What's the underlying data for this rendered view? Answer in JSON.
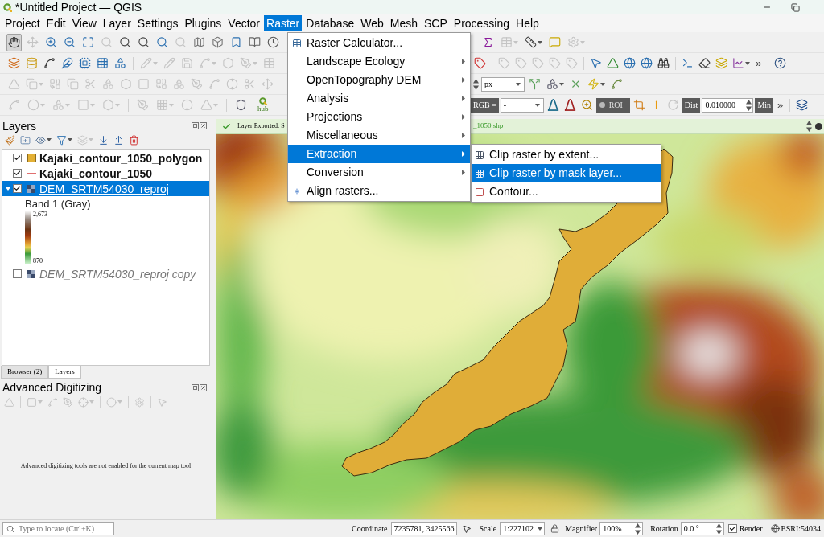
{
  "window": {
    "title": "*Untitled Project — QGIS"
  },
  "menu_bar": [
    {
      "label": "Project",
      "selected": false
    },
    {
      "label": "Edit",
      "selected": false
    },
    {
      "label": "View",
      "selected": false
    },
    {
      "label": "Layer",
      "selected": false
    },
    {
      "label": "Settings",
      "selected": false
    },
    {
      "label": "Plugins",
      "selected": false
    },
    {
      "label": "Vector",
      "selected": false
    },
    {
      "label": "Raster",
      "selected": true
    },
    {
      "label": "Database",
      "selected": false
    },
    {
      "label": "Web",
      "selected": false
    },
    {
      "label": "Mesh",
      "selected": false
    },
    {
      "label": "SCP",
      "selected": false
    },
    {
      "label": "Processing",
      "selected": false
    },
    {
      "label": "Help",
      "selected": false
    }
  ],
  "toolbars": [
    {
      "left": [
        {
          "kind": "button",
          "disabled": false,
          "pressed": true
        },
        {
          "kind": "button",
          "disabled": true,
          "pressed": false
        },
        {
          "kind": "button",
          "disabled": false,
          "pressed": false
        },
        {
          "kind": "button",
          "disabled": false,
          "pressed": false
        },
        {
          "kind": "button",
          "disabled": false,
          "pressed": false
        },
        {
          "kind": "button",
          "disabled": true,
          "pressed": false
        },
        {
          "kind": "button",
          "disabled": false,
          "pressed": false
        },
        {
          "kind": "button",
          "disabled": false,
          "pressed": false
        },
        {
          "kind": "button",
          "disabled": false,
          "pressed": false
        },
        {
          "kind": "button",
          "disabled": true,
          "pressed": false
        },
        {
          "kind": "button",
          "disabled": false,
          "pressed": false
        },
        {
          "kind": "button",
          "disabled": false,
          "pressed": false
        },
        {
          "kind": "button",
          "disabled": false,
          "pressed": false
        },
        {
          "kind": "button",
          "disabled": false,
          "pressed": false
        },
        {
          "kind": "button",
          "disabled": false,
          "pressed": false
        }
      ],
      "right": [
        {
          "kind": "button",
          "disabled": false
        },
        {
          "kind": "button",
          "disabled": true
        },
        {
          "kind": "button",
          "disabled": false
        },
        {
          "kind": "button",
          "disabled": false
        },
        {
          "kind": "button",
          "disabled": true
        }
      ]
    },
    {
      "left": [
        {
          "kind": "button",
          "disabled": false
        },
        {
          "kind": "button",
          "disabled": false
        },
        {
          "kind": "button",
          "disabled": false
        },
        {
          "kind": "button",
          "disabled": false
        },
        {
          "kind": "button",
          "disabled": false
        },
        {
          "kind": "button",
          "disabled": false
        },
        {
          "kind": "button",
          "disabled": false
        },
        {
          "kind": "button",
          "disabled": true
        },
        {
          "kind": "button",
          "disabled": true
        },
        {
          "kind": "button",
          "disabled": true
        },
        {
          "kind": "button",
          "disabled": true
        },
        {
          "kind": "button",
          "disabled": true
        },
        {
          "kind": "button",
          "disabled": true
        },
        {
          "kind": "button",
          "disabled": true
        }
      ],
      "right": [
        {
          "kind": "button",
          "disabled": false
        },
        {
          "kind": "button",
          "disabled": true
        },
        {
          "kind": "button",
          "disabled": true
        },
        {
          "kind": "button",
          "disabled": true
        },
        {
          "kind": "button",
          "disabled": true
        },
        {
          "kind": "button",
          "disabled": true
        },
        {
          "kind": "button",
          "disabled": false
        },
        {
          "kind": "button",
          "disabled": false
        },
        {
          "kind": "button",
          "disabled": false
        },
        {
          "kind": "button",
          "disabled": false
        },
        {
          "kind": "button",
          "disabled": false
        },
        {
          "kind": "button",
          "disabled": false
        },
        {
          "kind": "button",
          "disabled": false
        },
        {
          "kind": "button",
          "disabled": false
        },
        {
          "kind": "button",
          "disabled": false
        },
        {
          "kind": "overflow",
          "text": "»"
        },
        {
          "kind": "button",
          "disabled": false
        }
      ]
    },
    {
      "left": [
        {
          "kind": "button",
          "disabled": true
        },
        {
          "kind": "button",
          "disabled": true
        },
        {
          "kind": "button",
          "disabled": true
        },
        {
          "kind": "button",
          "disabled": true
        },
        {
          "kind": "button",
          "disabled": true
        },
        {
          "kind": "button",
          "disabled": true
        },
        {
          "kind": "button",
          "disabled": true
        },
        {
          "kind": "button",
          "disabled": true
        },
        {
          "kind": "button",
          "disabled": true
        },
        {
          "kind": "button",
          "disabled": true
        },
        {
          "kind": "button",
          "disabled": true
        },
        {
          "kind": "button",
          "disabled": true
        },
        {
          "kind": "button",
          "disabled": true
        },
        {
          "kind": "button",
          "disabled": true
        },
        {
          "kind": "button",
          "disabled": true
        }
      ],
      "right": [
        {
          "kind": "spin_arrows"
        },
        {
          "kind": "dropdown",
          "value": "px"
        },
        {
          "kind": "button",
          "disabled": false
        },
        {
          "kind": "button",
          "disabled": false
        },
        {
          "kind": "button",
          "disabled": false
        },
        {
          "kind": "button",
          "disabled": false
        },
        {
          "kind": "button",
          "disabled": false
        }
      ]
    },
    {
      "left": [
        {
          "kind": "button",
          "disabled": true
        },
        {
          "kind": "button",
          "disabled": true
        },
        {
          "kind": "button",
          "disabled": true
        },
        {
          "kind": "button",
          "disabled": true
        },
        {
          "kind": "button",
          "disabled": true
        },
        {
          "kind": "button",
          "disabled": true
        },
        {
          "kind": "button",
          "disabled": true
        },
        {
          "kind": "button",
          "disabled": true
        },
        {
          "kind": "button",
          "disabled": true
        },
        {
          "kind": "button",
          "disabled": false
        },
        {
          "kind": "hub",
          "text": "hub"
        }
      ],
      "right": [
        {
          "kind": "label",
          "text": "RGB ="
        },
        {
          "kind": "dropdown",
          "value": "-"
        },
        {
          "kind": "button",
          "disabled": false
        },
        {
          "kind": "button",
          "disabled": false
        },
        {
          "kind": "button",
          "disabled": false
        },
        {
          "kind": "toggle",
          "text": "ROI"
        },
        {
          "kind": "button",
          "disabled": false
        },
        {
          "kind": "button",
          "disabled": false
        },
        {
          "kind": "button",
          "disabled": true
        },
        {
          "kind": "label",
          "text": "Dist"
        },
        {
          "kind": "spinbox",
          "value": "0.010000"
        },
        {
          "kind": "label",
          "text": "Min"
        },
        {
          "kind": "overflow",
          "text": "»"
        },
        {
          "kind": "button",
          "disabled": false
        }
      ]
    }
  ],
  "raster_menu": {
    "items": [
      {
        "label": "Raster Calculator...",
        "kind": "action",
        "selected": false
      },
      {
        "label": "Landscape Ecology",
        "kind": "submenu",
        "selected": false
      },
      {
        "label": "OpenTopography DEM",
        "kind": "submenu",
        "selected": false
      },
      {
        "label": "Analysis",
        "kind": "submenu",
        "selected": false
      },
      {
        "label": "Projections",
        "kind": "submenu",
        "selected": false
      },
      {
        "label": "Miscellaneous",
        "kind": "submenu",
        "selected": false
      },
      {
        "label": "Extraction",
        "kind": "submenu",
        "selected": true
      },
      {
        "label": "Conversion",
        "kind": "submenu",
        "selected": false
      },
      {
        "label": "Align rasters...",
        "kind": "action",
        "selected": false
      }
    ]
  },
  "extraction_submenu": {
    "items": [
      {
        "label": "Clip raster by extent...",
        "selected": false
      },
      {
        "label": "Clip raster by mask layer...",
        "selected": true
      },
      {
        "label": "Contour...",
        "selected": false
      }
    ]
  },
  "layers_panel": {
    "title": "Layers",
    "toolbar": [
      {
        "disabled": false
      },
      {
        "disabled": false
      },
      {
        "disabled": false
      },
      {
        "disabled": false
      },
      {
        "disabled": true
      },
      {
        "disabled": false
      },
      {
        "disabled": false
      },
      {
        "disabled": false
      }
    ],
    "items": [
      {
        "name": "Kajaki_contour_1050_polygon",
        "kind": "polygon",
        "color": "#e3b034",
        "checked": true,
        "selected": false,
        "expanded": false,
        "bold": true
      },
      {
        "name": "Kajaki_contour_1050",
        "kind": "line",
        "color": "#e07070",
        "checked": true,
        "selected": false,
        "expanded": false,
        "bold": true
      },
      {
        "name": "DEM_SRTM54030_reproj",
        "kind": "raster",
        "checked": true,
        "selected": true,
        "expanded": true,
        "bold": false,
        "children": [
          {
            "kind": "band",
            "label": "Band 1 (Gray)"
          },
          {
            "kind": "ramp",
            "max": "2,673",
            "min": "870"
          }
        ]
      },
      {
        "name": "DEM_SRTM54030_reproj copy",
        "kind": "raster",
        "checked": false,
        "selected": false,
        "expanded": false,
        "bold": false
      }
    ]
  },
  "dock_tabs": [
    {
      "label": "Browser (2)",
      "selected": false
    },
    {
      "label": "Layers",
      "selected": true
    }
  ],
  "advanced_digitizing": {
    "title": "Advanced Digitizing",
    "toolbar": [
      {
        "disabled": true
      },
      {
        "disabled": true
      },
      {
        "disabled": true
      },
      {
        "disabled": true
      },
      {
        "disabled": true
      },
      {
        "disabled": true
      },
      {
        "disabled": true
      },
      {
        "disabled": true
      }
    ],
    "message": "Advanced digitizing tools are not enabled for the current map tool"
  },
  "message_bar": {
    "text": "Layer Exported: S",
    "link": "_1050.shp"
  },
  "status_bar": {
    "locate_placeholder": "Type to locate (Ctrl+K)",
    "coordinate": {
      "label": "Coordinate",
      "value": "7235781, 3425566"
    },
    "scale": {
      "label": "Scale",
      "value": "1:227102"
    },
    "magnifier": {
      "label": "Magnifier",
      "value": "100%"
    },
    "rotation": {
      "label": "Rotation",
      "value": "0.0 °"
    },
    "render": {
      "label": "Render",
      "checked": true
    },
    "crs": "ESRI:54034"
  }
}
